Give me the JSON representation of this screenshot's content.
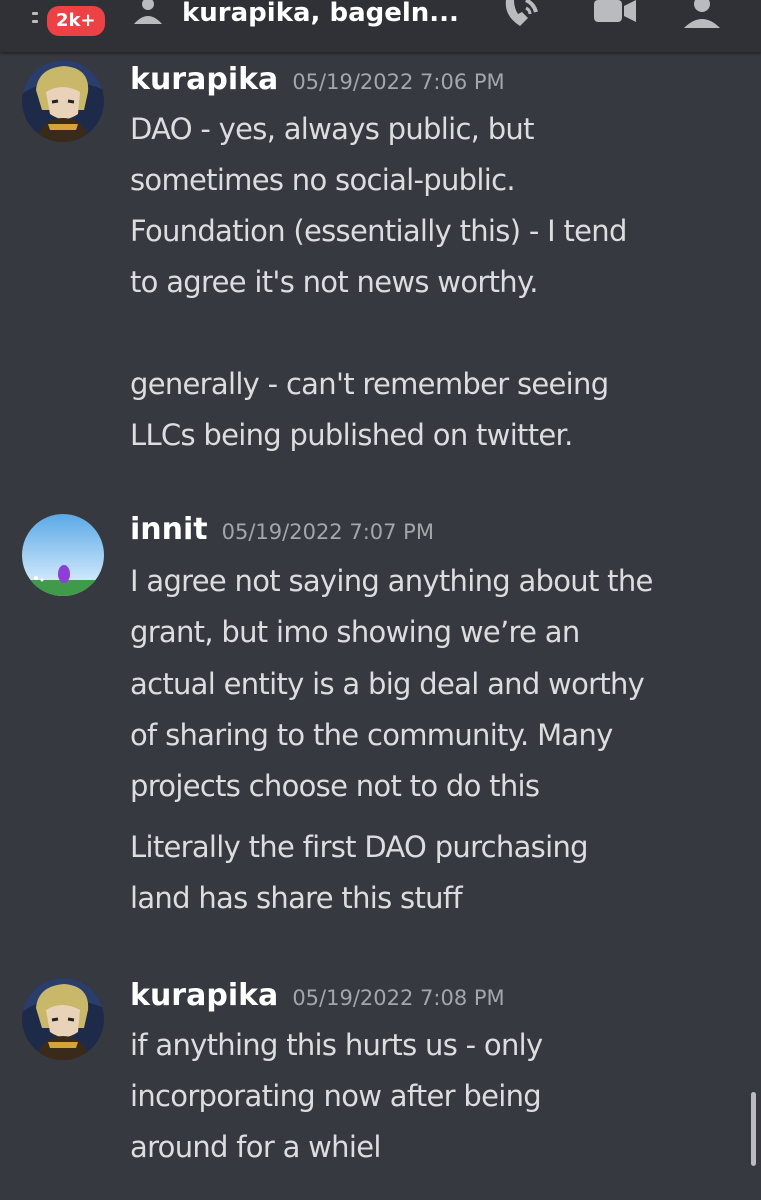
{
  "header": {
    "notification_badge": "2k+",
    "channel_title": "kurapika, bageln...",
    "icons": [
      "menu-icon",
      "person-icon",
      "call-icon",
      "video-icon",
      "members-icon"
    ]
  },
  "messages": [
    {
      "username": "kurapika",
      "timestamp": "05/19/2022 7:06 PM",
      "avatar": "anime-character-avatar",
      "lines": [
        "DAO - yes, always public, but",
        "sometimes no social-public.",
        "Foundation (essentially this) - I tend",
        "to agree it's not news worthy.",
        "",
        "generally - can't remember seeing",
        "LLCs being published on twitter."
      ]
    },
    {
      "username": "innit",
      "timestamp": "05/19/2022 7:07 PM",
      "avatar": "landscape-avatar",
      "lines": [
        "I agree not saying anything about the",
        "grant, but imo showing we’re an",
        "actual entity is a big deal and worthy",
        "of sharing to the community. Many",
        "projects choose not to do this",
        "Literally the first DAO purchasing",
        "land has share this stuff"
      ]
    },
    {
      "username": "kurapika",
      "timestamp": "05/19/2022 7:08 PM",
      "avatar": "anime-character-avatar",
      "lines": [
        "if anything this hurts us - only",
        "incorporating now after being",
        "around for a whiel"
      ]
    }
  ],
  "colors": {
    "background": "#36393f",
    "topbar": "#2f3136",
    "badge": "#ed4245",
    "username": "#ffffff",
    "timestamp": "#a3a6aa",
    "text": "#dcddde"
  }
}
